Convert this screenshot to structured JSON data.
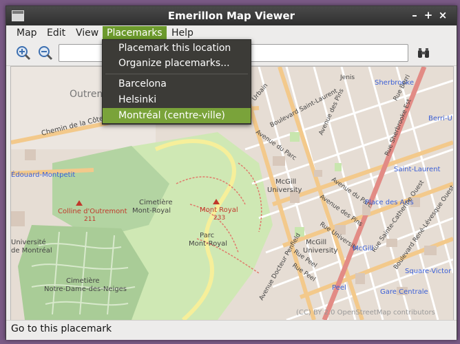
{
  "window": {
    "title": "Emerillon Map Viewer"
  },
  "window_controls": {
    "minimize": "–",
    "maximize": "+",
    "close": "×"
  },
  "menubar": {
    "items": [
      {
        "label": "Map",
        "mnemonic": "M"
      },
      {
        "label": "Edit",
        "mnemonic": "E"
      },
      {
        "label": "View",
        "mnemonic": "V"
      },
      {
        "label": "Placemarks",
        "mnemonic": "P"
      },
      {
        "label": "Help",
        "mnemonic": "H"
      }
    ]
  },
  "toolbar": {
    "zoom_in_icon": "zoom-in-icon",
    "zoom_out_icon": "zoom-out-icon",
    "search_value": "",
    "find_icon": "binoculars-icon"
  },
  "placemarks_menu": {
    "items": [
      "Placemark this location",
      "Organize placemarks...",
      "Barcelona",
      "Helsinki",
      "Montréal (centre-ville)"
    ],
    "highlighted": "Montréal (centre-ville)"
  },
  "map": {
    "labels": {
      "outremont": "Outremont",
      "chemin_cote": "Chemin de la Côte-Sainte-Catherine",
      "edouard_montpetit": "Édouard-Montpetit",
      "colline": "Colline d'Outremont",
      "colline_elev": "211",
      "cimetiere_mr_1": "Cimetière",
      "cimetiere_mr_2": "Mont-Royal",
      "mont_royal": "Mont Royal",
      "mont_royal_elev": "233",
      "parc_1": "Parc",
      "parc_2": "Mont-Royal",
      "universite_1": "Université",
      "universite_2": "de Montréal",
      "cimetiere_nd_1": "Cimetière",
      "cimetiere_nd_2": "Notre-Dame-des-Neiges",
      "mcgill_1": "McGill",
      "mcgill_2": "University",
      "mcgill_u1": "McGill",
      "mcgill_u2": "University",
      "jenis": "Jenis",
      "urbain": "Urbain",
      "bd_st_laurent": "Boulevard Saint-Laurent",
      "av_du_parc_1": "Avenue du Parc",
      "av_des_pins_1": "Avenue des Pins",
      "av_du_parc_2": "Avenue du Parc",
      "av_des_pins_2": "Avenue des Pins",
      "rue_university": "Rue University",
      "rue_peel": "Rue Peel",
      "av_docteur_penfield": "Avenue Docteur Penfield",
      "rue_peel_2": "Rue Peel",
      "sherbrooke": "Sherbrooke",
      "rue_berri": "Rue Berri",
      "rue_sherbrooke_est": "Rue Sherbrooke Est",
      "berri_uqam": "Berri-U",
      "saint_laurent": "Saint-Laurent",
      "place_des_arts": "Place des Arts",
      "rue_ste_catherine": "Rue Sainte-Catherine Ouest",
      "bd_rene_levesque": "Boulevard René-Lévesque Ouest",
      "mcgill_station": "McGill",
      "square_victoria": "Square-Victor",
      "peel_station": "Peel",
      "gare_centrale": "Gare Centrale",
      "attribution": "(CC) BY 2.0 OpenStreetMap contributors"
    }
  },
  "statusbar": {
    "text": "Go to this placemark"
  },
  "colors": {
    "accent": "#7aa33a",
    "titlebar": "#3a3a3a",
    "menu_bg": "#3c3b37",
    "park": "#c8e6ae",
    "cemetery": "#aed1a0",
    "urban": "#e4dcd2",
    "major_road": "#f3c98b",
    "motorway": "#e8908a",
    "metro_label": "#3b5fd6"
  }
}
